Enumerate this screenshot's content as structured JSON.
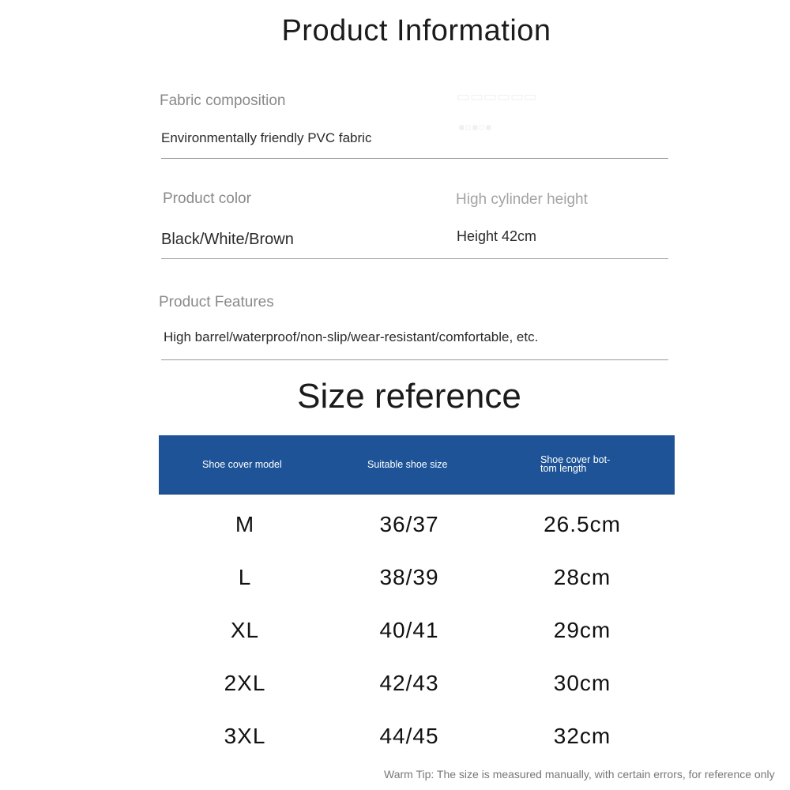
{
  "product_info": {
    "title": "Product Information",
    "fabric": {
      "label": "Fabric composition",
      "value": "Environmentally friendly PVC fabric"
    },
    "color": {
      "label": "Product color",
      "value": "Black/White/Brown"
    },
    "height": {
      "label": "High cylinder height",
      "value": "Height 42cm"
    },
    "features": {
      "label": "Product Features",
      "value": "High barrel/waterproof/non-slip/wear-resistant/comfortable, etc."
    }
  },
  "size_reference": {
    "title": "Size reference",
    "header_color": "#1e5497",
    "columns": [
      "Shoe cover model",
      "Suitable shoe size",
      "Shoe cover bottom length"
    ],
    "columns_display": {
      "c3_line1": "Shoe cover bot-",
      "c3_line2": "tom length"
    },
    "rows": [
      [
        "M",
        "36/37",
        "26.5cm"
      ],
      [
        "L",
        "38/39",
        "28cm"
      ],
      [
        "XL",
        "40/41",
        "29cm"
      ],
      [
        "2XL",
        "42/43",
        "30cm"
      ],
      [
        "3XL",
        "44/45",
        "32cm"
      ]
    ]
  },
  "footer": {
    "tip": "Warm Tip: The size is measured manually, with certain errors, for reference only"
  }
}
